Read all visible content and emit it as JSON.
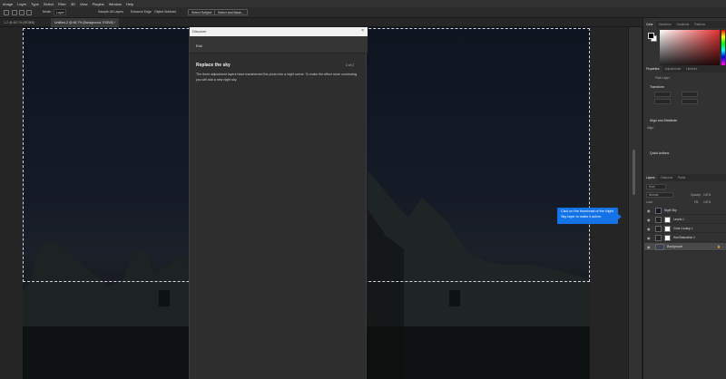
{
  "menu": [
    "Image",
    "Layer",
    "Type",
    "Select",
    "Filter",
    "3D",
    "View",
    "Plugins",
    "Window",
    "Help"
  ],
  "options": {
    "mode_label": "Mode:",
    "layer_value": "Layer",
    "sample_all": "Sample All Layers",
    "enhance_edge": "Enhance Edge",
    "object_subtract": "Object Subtract",
    "select_subject": "Select Subject",
    "select_mask": "Select and Mask..."
  },
  "tabs": [
    {
      "label": "1-2 @ 66.7% (RGB/8)"
    },
    {
      "label": "Untitled-2 @ 66.7% (Background, RGB/8) *"
    }
  ],
  "discover": {
    "header": "Discover",
    "exit": "Exit",
    "title": "Replace the sky",
    "step": "2 of 2",
    "body": "The three adjustment layers have transformed the photo into a night scene. To make the effect more convincing you will add a new night sky."
  },
  "tooltip": {
    "text": "Click on the thumbnail of the Night Sky layer to make it active."
  },
  "right_panel": {
    "color_tabs": [
      "Color",
      "Swatches",
      "Gradients",
      "Patterns"
    ],
    "properties_tabs": [
      "Properties",
      "Adjustments",
      "Libraries"
    ],
    "pixel_layer": "Pixel Layer",
    "transform": "Transform",
    "align": "Align and Distribute",
    "align_sub": "Align:",
    "quick_actions": "Quick Actions",
    "layers_tabs": [
      "Layers",
      "Channels",
      "Paths"
    ],
    "kind": "Kind",
    "blend": "Normal",
    "opacity_label": "Opacity:",
    "opacity_value": "100%",
    "lock_label": "Lock:",
    "fill_label": "Fill:",
    "fill_value": "100%",
    "layers": [
      {
        "name": "Night Sky"
      },
      {
        "name": "Levels 1"
      },
      {
        "name": "Color Lookup 1"
      },
      {
        "name": "Hue/Saturation 1"
      },
      {
        "name": "Background"
      }
    ]
  },
  "colors": {
    "accent": "#1473e6",
    "selection": "#cfd5dd"
  }
}
